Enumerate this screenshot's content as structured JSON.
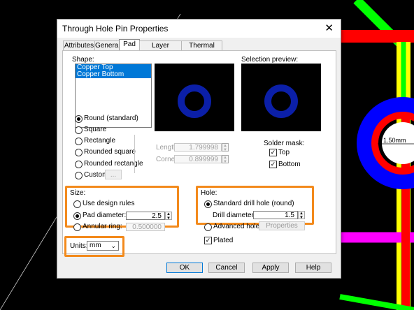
{
  "dialog": {
    "title": "Through Hole Pin Properties",
    "close_glyph": "✕",
    "tabs": [
      {
        "label": "Attributes"
      },
      {
        "label": "General"
      },
      {
        "label": "Pad",
        "active": true
      },
      {
        "label": "Layer settings"
      },
      {
        "label": "Thermal relief"
      }
    ]
  },
  "shape": {
    "label": "Shape:",
    "layers": [
      "Copper Top",
      "Copper Bottom"
    ],
    "options": [
      "Round (standard)",
      "Square",
      "Rectangle",
      "Rounded square",
      "Rounded rectangle",
      "Custom"
    ],
    "selected": "Round (standard)",
    "custom_button": "...",
    "length_label": "Length:",
    "length_value": "1.799998",
    "corner_radius_label": "Corner radius:",
    "corner_radius_value": "0.899999"
  },
  "selection_preview": {
    "label": "Selection preview:"
  },
  "solder_mask": {
    "label": "Solder mask:",
    "top_label": "Top",
    "top_checked": true,
    "bottom_label": "Bottom",
    "bottom_checked": true
  },
  "size": {
    "label": "Size:",
    "use_design_rules": "Use design rules",
    "pad_diameter_label": "Pad diameter:",
    "pad_diameter_value": "2.5",
    "annular_ring_label": "Annular ring:",
    "annular_ring_value": "0.500000",
    "selected": "Pad diameter"
  },
  "hole": {
    "label": "Hole:",
    "standard": "Standard drill hole (round)",
    "drill_diameter_label": "Drill diameter:",
    "drill_diameter_value": "1.5",
    "advanced": "Advanced hole",
    "properties_button": "Properties",
    "plated_label": "Plated",
    "plated_checked": true
  },
  "units": {
    "label": "Units:",
    "value": "mm"
  },
  "buttons": {
    "ok": "OK",
    "cancel": "Cancel",
    "apply": "Apply",
    "help": "Help"
  },
  "canvas": {
    "dimension_label": "1.50mm"
  },
  "colors": {
    "accent": "#0078d7",
    "highlight": "#f38a1c",
    "pad_blue": "#0000ff",
    "preview_ring": "#0b1fa8",
    "trace_red": "#ff0000",
    "trace_green": "#00ff00",
    "trace_magenta": "#ff00ff",
    "trace_yellow": "#ffff00"
  },
  "icons": {
    "spin": "spin-arrows-icon",
    "dropdown": "chevron-down-icon",
    "check": "checkmark-icon"
  }
}
